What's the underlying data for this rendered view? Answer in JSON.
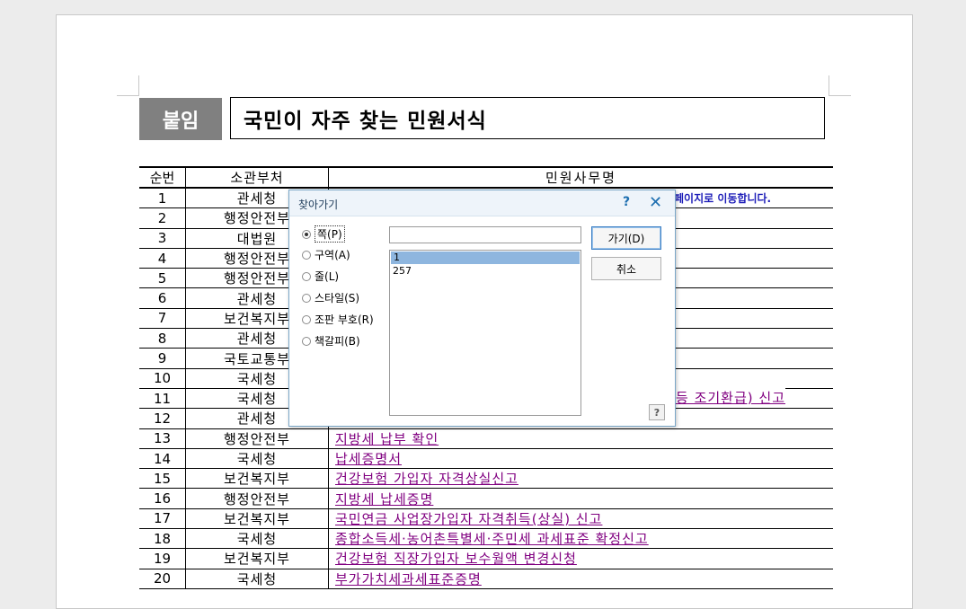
{
  "header": {
    "badge": "붙임",
    "title": "국민이 자주 찾는 민원서식"
  },
  "table": {
    "columns": [
      "순번",
      "소관부처",
      "민원사무명"
    ],
    "rows": [
      {
        "no": "1",
        "dept": "관세청",
        "name": ""
      },
      {
        "no": "2",
        "dept": "행정안전부",
        "name": ""
      },
      {
        "no": "3",
        "dept": "대법원",
        "name": ""
      },
      {
        "no": "4",
        "dept": "행정안전부",
        "name": ""
      },
      {
        "no": "5",
        "dept": "행정안전부",
        "name": ""
      },
      {
        "no": "6",
        "dept": "관세청",
        "name": ""
      },
      {
        "no": "7",
        "dept": "보건복지부",
        "name": ""
      },
      {
        "no": "8",
        "dept": "관세청",
        "name": ""
      },
      {
        "no": "9",
        "dept": "국토교통부",
        "name": ""
      },
      {
        "no": "10",
        "dept": "국세청",
        "name": ""
      },
      {
        "no": "11",
        "dept": "국세청",
        "name": ""
      },
      {
        "no": "12",
        "dept": "관세청",
        "name": ""
      },
      {
        "no": "13",
        "dept": "행정안전부",
        "name": "지방세 납부 확인"
      },
      {
        "no": "14",
        "dept": "국세청",
        "name": "납세증명서"
      },
      {
        "no": "15",
        "dept": "보건복지부",
        "name": "건강보험 가입자 자격상실신고"
      },
      {
        "no": "16",
        "dept": "행정안전부",
        "name": "지방세 납세증명"
      },
      {
        "no": "17",
        "dept": "보건복지부",
        "name": "국민연금 사업장가입자 자격취득(상실) 신고"
      },
      {
        "no": "18",
        "dept": "국세청",
        "name": "종합소득세·농어촌특별세·주민세 과세표준 확정신고"
      },
      {
        "no": "19",
        "dept": "보건복지부",
        "name": "건강보험 직장가입자 보수월액 변경신청"
      },
      {
        "no": "20",
        "dept": "국세청",
        "name": "부가가치세과세표준증명"
      }
    ],
    "note_text": "페이지로 이동합니다.",
    "partial_row11": "등 조기환급) 신고"
  },
  "dialog": {
    "title": "찾아가기",
    "help": "?",
    "close": "✕",
    "options": [
      "쪽(P)",
      "구역(A)",
      "줄(L)",
      "스타일(S)",
      "조판 부호(R)",
      "책갈피(B)"
    ],
    "selected_option": "쪽(P)",
    "input_value": "",
    "list_items": [
      "1",
      "257"
    ],
    "selected_item": "1",
    "go_label": "가기(D)",
    "cancel_label": "취소",
    "help_button": "?"
  }
}
